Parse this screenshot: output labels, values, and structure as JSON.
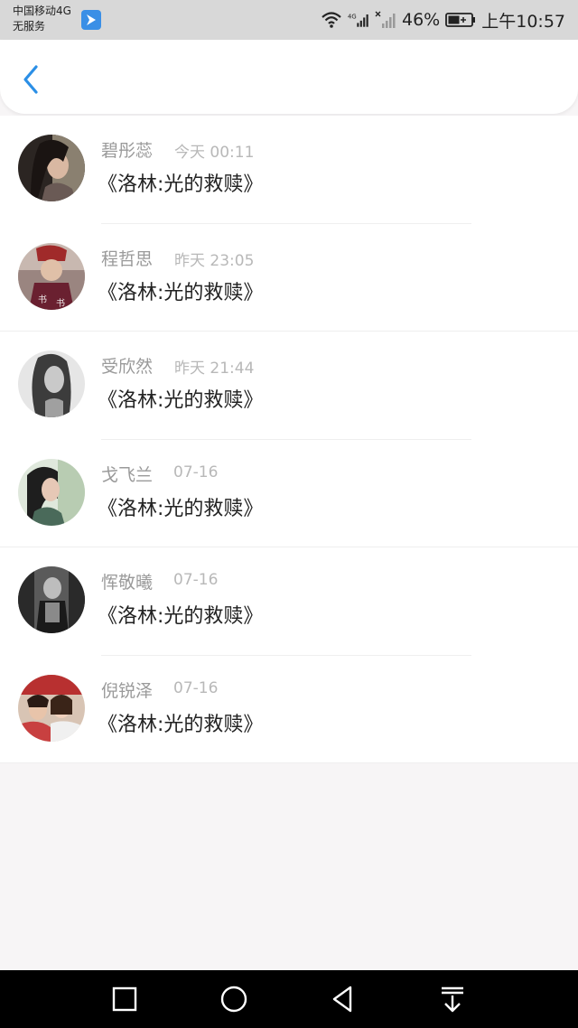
{
  "status_bar": {
    "carrier": "中国移动4G",
    "service": "无服务",
    "network": "4G",
    "battery": "46%",
    "time": "上午10:57"
  },
  "header": {
    "back_icon": "chevron-left-icon",
    "accent": "#2b8fe6"
  },
  "comments": [
    {
      "name": "碧彤蕊",
      "time": "今天 00:11",
      "title": "《洛林:光的救赎》"
    },
    {
      "name": "程哲思",
      "time": "昨天 23:05",
      "title": "《洛林:光的救赎》"
    },
    {
      "name": "受欣然",
      "time": "昨天 21:44",
      "title": "《洛林:光的救赎》"
    },
    {
      "name": "戈飞兰",
      "time": "07-16",
      "title": "《洛林:光的救赎》"
    },
    {
      "name": "恽敬曦",
      "time": "07-16",
      "title": "《洛林:光的救赎》"
    },
    {
      "name": "倪锐泽",
      "time": "07-16",
      "title": "《洛林:光的救赎》"
    }
  ],
  "navbar": {
    "icons": [
      "square-icon",
      "circle-icon",
      "triangle-back-icon",
      "notification-down-icon"
    ]
  }
}
